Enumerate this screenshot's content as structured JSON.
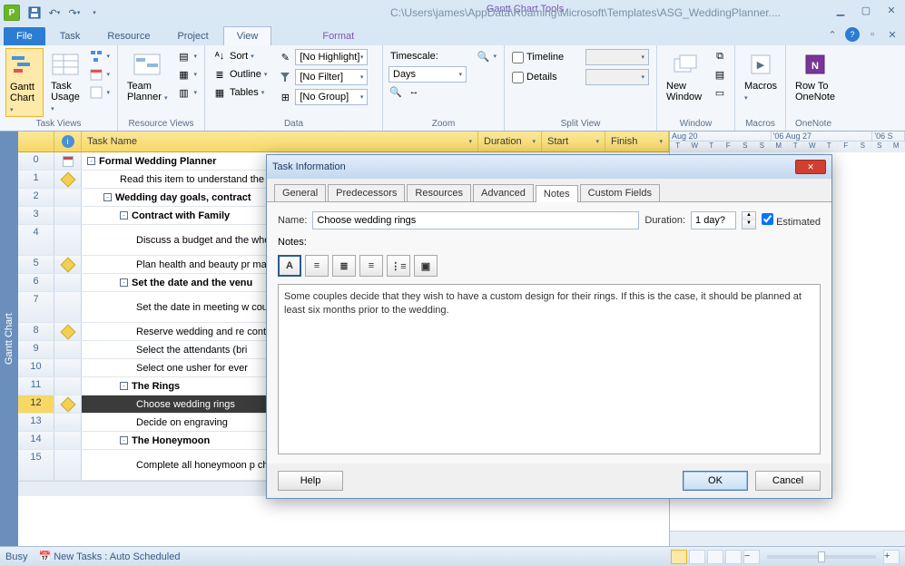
{
  "title_path": "C:\\Users\\james\\AppData\\Roaming\\Microsoft\\Templates\\ASG_WeddingPlanner....",
  "chart_tools": "Gantt Chart Tools",
  "tabs": {
    "file": "File",
    "task": "Task",
    "resource": "Resource",
    "project": "Project",
    "view": "View",
    "format": "Format"
  },
  "ribbon": {
    "task_views": "Task Views",
    "resource_views": "Resource Views",
    "data": "Data",
    "zoom": "Zoom",
    "split_view": "Split View",
    "window": "Window",
    "macros": "Macros",
    "onenote": "OneNote",
    "gantt_chart": "Gantt Chart",
    "task_usage": "Task Usage",
    "team_planner": "Team Planner",
    "sort": "Sort",
    "outline": "Outline",
    "tables": "Tables",
    "highlight": "[No Highlight]",
    "filter": "[No Filter]",
    "group": "[No Group]",
    "timescale": "Timescale:",
    "days": "Days",
    "timeline": "Timeline",
    "details": "Details",
    "new_window": "New Window",
    "macros_btn": "Macros",
    "row_to_onenote": "Row To OneNote"
  },
  "columns": {
    "task_name": "Task Name",
    "duration": "Duration",
    "start": "Start",
    "finish": "Finish"
  },
  "time_header": {
    "w1": "Aug 20",
    "w2": "'06 Aug 27",
    "w3": "'06 S"
  },
  "days": [
    "T",
    "W",
    "T",
    "F",
    "S",
    "S",
    "M",
    "T",
    "W",
    "T",
    "F",
    "S",
    "S",
    "M"
  ],
  "side_tab": "Gantt Chart",
  "rows": [
    {
      "n": 0,
      "ind": "cal",
      "txt": "Formal Wedding Planner",
      "bold": true,
      "lvl": 0,
      "tog": "-"
    },
    {
      "n": 1,
      "ind": "note",
      "txt": "Read this item to understand the",
      "lvl": 2
    },
    {
      "n": 2,
      "ind": "",
      "txt": "Wedding day goals, contract",
      "bold": true,
      "lvl": 1,
      "tog": "-"
    },
    {
      "n": 3,
      "ind": "",
      "txt": "Contract with Family",
      "bold": true,
      "lvl": 2,
      "tog": "-"
    },
    {
      "n": 4,
      "ind": "",
      "txt": "Discuss a budget and the who pays for what",
      "lvl": 3
    },
    {
      "n": 5,
      "ind": "note",
      "txt": "Plan health and beauty pr makeup)",
      "lvl": 3
    },
    {
      "n": 6,
      "ind": "",
      "txt": "Set the date and the venu",
      "bold": true,
      "lvl": 2,
      "tog": "-"
    },
    {
      "n": 7,
      "ind": "",
      "txt": "Set the date in meeting w counseling",
      "lvl": 3
    },
    {
      "n": 8,
      "ind": "note",
      "txt": "Reserve wedding and re contacts",
      "lvl": 3
    },
    {
      "n": 9,
      "ind": "",
      "txt": "Select the attendants (bri",
      "lvl": 3
    },
    {
      "n": 10,
      "ind": "",
      "txt": "Select one usher for ever",
      "lvl": 3
    },
    {
      "n": 11,
      "ind": "",
      "txt": "The Rings",
      "bold": true,
      "lvl": 2,
      "tog": "-"
    },
    {
      "n": 12,
      "ind": "note",
      "txt": "Choose wedding rings",
      "lvl": 3,
      "sel": true
    },
    {
      "n": 13,
      "ind": "",
      "txt": "Decide on engraving",
      "lvl": 3
    },
    {
      "n": 14,
      "ind": "",
      "txt": "The Honeymoon",
      "bold": true,
      "lvl": 2,
      "tog": "-"
    },
    {
      "n": 15,
      "ind": "",
      "txt": "Complete all honeymoon p check on visas, passports and inoculations.",
      "lvl": 3
    }
  ],
  "dialog": {
    "title": "Task Information",
    "tabs": [
      "General",
      "Predecessors",
      "Resources",
      "Advanced",
      "Notes",
      "Custom Fields"
    ],
    "active_tab": "Notes",
    "name_label": "Name:",
    "name_value": "Choose wedding rings",
    "duration_label": "Duration:",
    "duration_value": "1 day?",
    "estimated": "Estimated",
    "notes_label": "Notes:",
    "notes_text": "Some couples decide that they wish to have a custom design for their rings. If this is the case, it should be planned at least six months prior to the wedding.",
    "help": "Help",
    "ok": "OK",
    "cancel": "Cancel"
  },
  "status": {
    "busy": "Busy",
    "new_tasks": "New Tasks : Auto Scheduled"
  }
}
